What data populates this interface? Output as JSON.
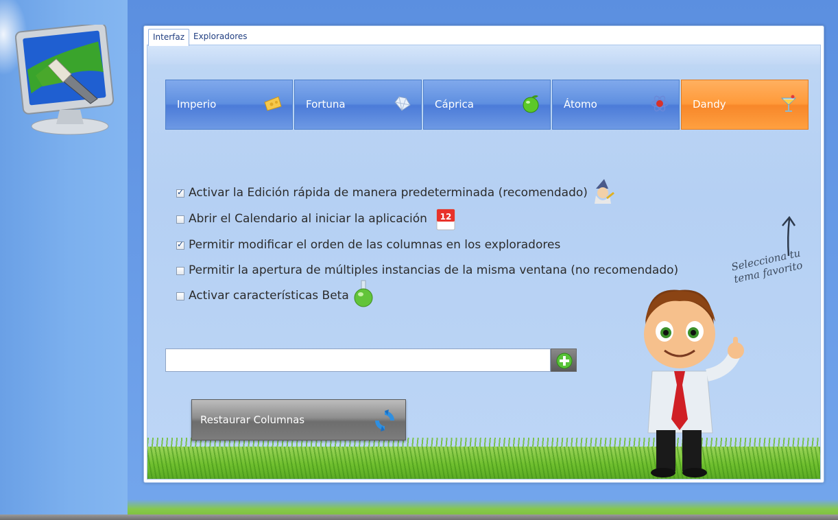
{
  "tabs": [
    {
      "label": "Interfaz",
      "active": true
    },
    {
      "label": "Exploradores",
      "active": false
    }
  ],
  "themes": [
    {
      "label": "Imperio",
      "icon": "cheese-icon",
      "active": false
    },
    {
      "label": "Fortuna",
      "icon": "diamond-icon",
      "active": false
    },
    {
      "label": "Cáprica",
      "icon": "apple-icon",
      "active": false
    },
    {
      "label": "Átomo",
      "icon": "atom-icon",
      "active": false
    },
    {
      "label": "Dandy",
      "icon": "cocktail-icon",
      "active": true
    }
  ],
  "options": [
    {
      "label": "Activar la Edición rápida de manera predeterminada (recomendado)",
      "checked": true,
      "icon": "wizard-icon"
    },
    {
      "label": "Abrir el Calendario al iniciar la aplicación",
      "checked": false,
      "icon": "calendar-icon",
      "icon_text": "12"
    },
    {
      "label": "Permitir modificar el orden de las columnas en los exploradores",
      "checked": true
    },
    {
      "label": "Permitir la apertura de múltiples instancias de la misma ventana (no recomendado)",
      "checked": false
    },
    {
      "label": "Activar características Beta",
      "checked": false,
      "icon": "flask-icon"
    }
  ],
  "column_input": {
    "value": "",
    "placeholder": ""
  },
  "restore_button": {
    "label": "Restaurar Columnas"
  },
  "hint": {
    "line1": "Selecciona tu",
    "line2": "tema favorito"
  },
  "colors": {
    "accent_orange": "#ff9a3a",
    "theme_blue": "#5f8fe0",
    "background_blue": "#5d93de"
  }
}
